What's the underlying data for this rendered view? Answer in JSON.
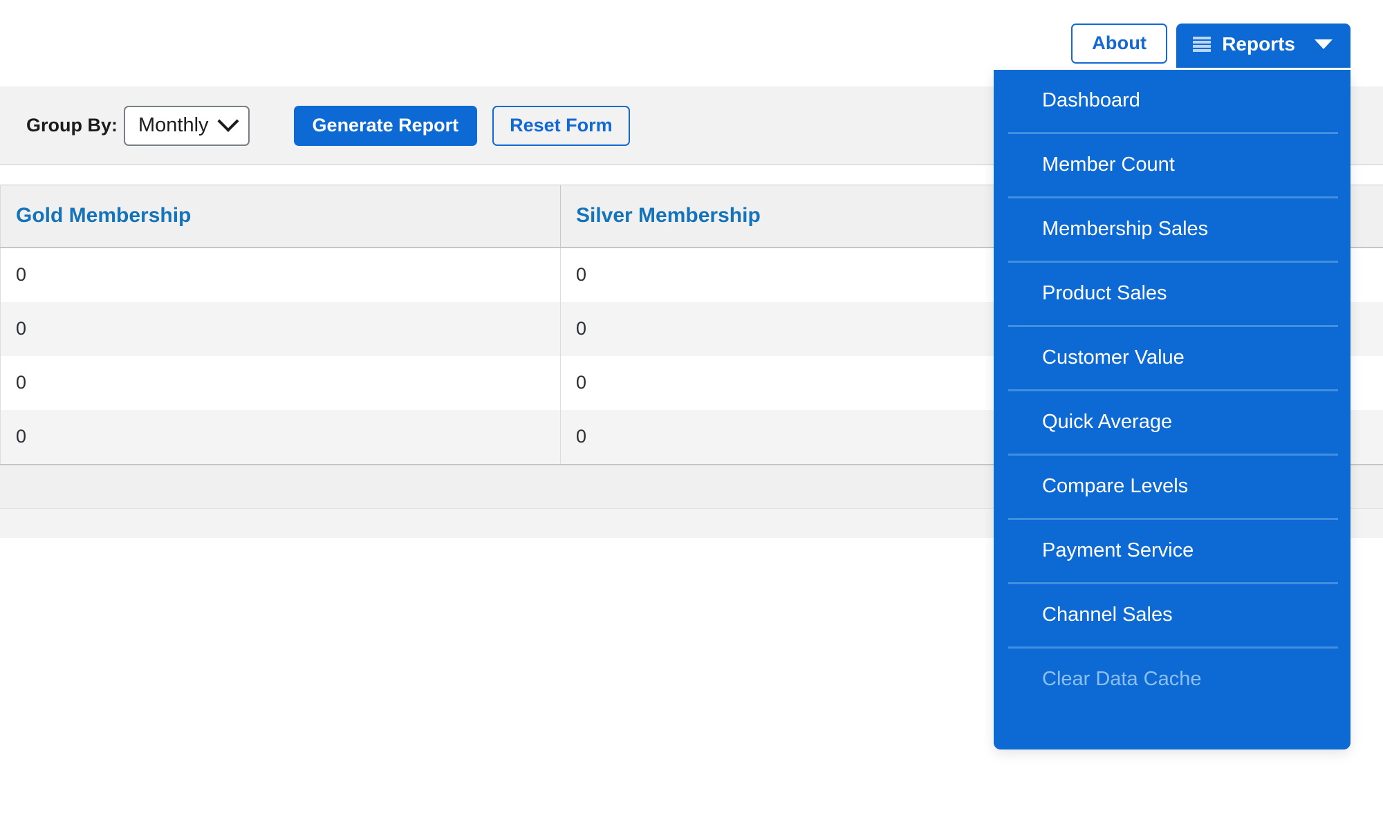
{
  "topnav": {
    "about_label": "About",
    "reports_label": "Reports",
    "reports_icon": "list-icon",
    "caret_icon": "chevron-down-icon"
  },
  "reports_menu": {
    "items": [
      {
        "label": "Dashboard",
        "disabled": false
      },
      {
        "label": "Member Count",
        "disabled": false
      },
      {
        "label": "Membership Sales",
        "disabled": false
      },
      {
        "label": "Product Sales",
        "disabled": false
      },
      {
        "label": "Customer Value",
        "disabled": false
      },
      {
        "label": "Quick Average",
        "disabled": false
      },
      {
        "label": "Compare Levels",
        "disabled": false
      },
      {
        "label": "Payment Service",
        "disabled": false
      },
      {
        "label": "Channel Sales",
        "disabled": false
      },
      {
        "label": "Clear Data Cache",
        "disabled": true
      }
    ]
  },
  "toolbar": {
    "group_by_label": "Group By:",
    "group_by_value": "Monthly",
    "group_by_options": [
      "Monthly"
    ],
    "generate_label": "Generate Report",
    "reset_label": "Reset Form",
    "select_caret_icon": "chevron-down-icon"
  },
  "table": {
    "columns": [
      "Gold Membership",
      "Silver Membership",
      ""
    ],
    "rows": [
      [
        "0",
        "0",
        ""
      ],
      [
        "0",
        "0",
        ""
      ],
      [
        "0",
        "0",
        ""
      ],
      [
        "0",
        "0",
        ""
      ]
    ]
  },
  "colors": {
    "accent": "#0d6ad4",
    "link": "#1269d3",
    "header_text": "#1573b9",
    "menu_separator": "#428fe0",
    "disabled_text": "#8dc0ef",
    "toolbar_bg": "#f2f2f2",
    "table_header_bg": "#f0f0f0",
    "row_alt_bg": "#f4f4f4"
  }
}
